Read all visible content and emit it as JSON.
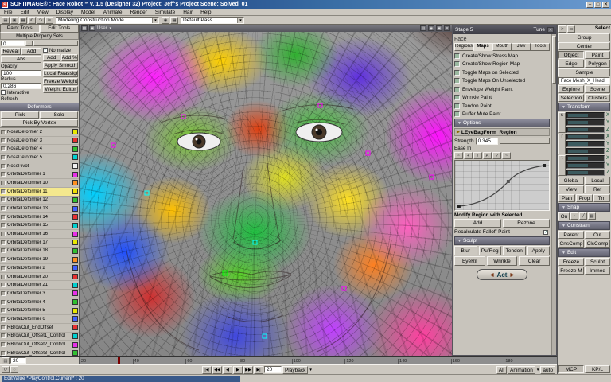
{
  "title_bar": {
    "app_icon": "S",
    "title": "SOFTIMAGE® : Face Robot™ v. 1.5 (Designer 32) Project: Jeff's Project    Scene: Solved_01",
    "window_buttons": {
      "minimize": "–",
      "maximize": "□",
      "close": "✕"
    }
  },
  "menu_bar": {
    "items": [
      "File",
      "Edit",
      "View",
      "Display",
      "Model",
      "Animate",
      "Render",
      "Simulate",
      "Hair",
      "Help"
    ]
  },
  "toolbar": {
    "mode_combo": "Modeling Construction Mode",
    "pass_combo": "Default Pass"
  },
  "paint_panel": {
    "tabs": [
      "Paint Tools",
      "Edit Tools"
    ],
    "title": "Multiple Property Sets",
    "weight_value": "0",
    "left": {
      "reveal": "Reveal",
      "add": "Add",
      "abs": "Abs",
      "opacity_label": "Opacity",
      "opacity_value": "100",
      "radius_label": "Radius",
      "radius_value": "0.286",
      "interactive_refresh": "Interactive Refresh"
    },
    "right": {
      "normalize": "Normalize",
      "add": "Add",
      "add_pct": "Add %",
      "apply_smooth": "Apply Smooth",
      "local_reassign": "Local Reassign",
      "freeze_weights": "Freeze Weights",
      "weight_editor": "Weight Editor"
    },
    "deformers_header": "Deformers",
    "pick": "Pick",
    "solo": "Solo",
    "pick_by_vertex": "Pick By Vertex"
  },
  "deformers": {
    "items": [
      {
        "label": "NosaDeformer 2",
        "color": "#e8e800"
      },
      {
        "label": "NosaDeformer 3",
        "color": "#e83030"
      },
      {
        "label": "NosaDeformer 4",
        "color": "#30c030"
      },
      {
        "label": "NosaDeformer 5",
        "color": "#00d0d0"
      },
      {
        "label": "NosePivot",
        "color": "#f0f0f0"
      },
      {
        "label": "OrbitalDeformer 1",
        "color": "#e830e8"
      },
      {
        "label": "OrbitalDeformer 10",
        "color": "#ff9020"
      },
      {
        "label": "OrbitalDeformer 11",
        "color": "#f0e000",
        "selected": true
      },
      {
        "label": "OrbitalDeformer 12",
        "color": "#30c030"
      },
      {
        "label": "OrbitalDeformer 13",
        "color": "#4060ff"
      },
      {
        "label": "OrbitalDeformer 14",
        "color": "#e83030"
      },
      {
        "label": "OrbitalDeformer 15",
        "color": "#00d0d0"
      },
      {
        "label": "OrbitalDeformer 16",
        "color": "#e830e8"
      },
      {
        "label": "OrbitalDeformer 17",
        "color": "#e8e800"
      },
      {
        "label": "OrbitalDeformer 18",
        "color": "#30c030"
      },
      {
        "label": "OrbitalDeformer 19",
        "color": "#ff9020"
      },
      {
        "label": "OrbitalDeformer 2",
        "color": "#4060ff"
      },
      {
        "label": "OrbitalDeformer 20",
        "color": "#e83030"
      },
      {
        "label": "OrbitalDeformer 21",
        "color": "#00d0d0"
      },
      {
        "label": "OrbitalDeformer 3",
        "color": "#e830e8"
      },
      {
        "label": "OrbitalDeformer 4",
        "color": "#30c030"
      },
      {
        "label": "OrbitalDeformer 5",
        "color": "#e8e800"
      },
      {
        "label": "OrbitalDeformer 6",
        "color": "#4060ff"
      },
      {
        "label": "RBrowOut_EndOffset",
        "color": "#e83030"
      },
      {
        "label": "RBrowOut_Offset1_Control",
        "color": "#00d0d0"
      },
      {
        "label": "RBrowOut_Offset2_Control",
        "color": "#e830e8"
      },
      {
        "label": "RBrowOut_Offset3_Control",
        "color": "#30c030"
      }
    ]
  },
  "viewport": {
    "view": "User"
  },
  "tune_panel": {
    "title": "Stage 5",
    "title2": "Tune",
    "face": {
      "label": "Face",
      "tabs": [
        "Regions",
        "Maps",
        "Mouth",
        "Jaw",
        "Tools"
      ],
      "active_tab": "Maps",
      "items": [
        "Create/Show Stress Map",
        "Create/Show Region Map",
        "Toggle Maps on Selected",
        "Toggle Maps On Unselected",
        "Envelope Weight Paint",
        "Wrinkle Paint",
        "Tendon Paint",
        "Puffer Mute Paint"
      ]
    },
    "options": {
      "header": "Options",
      "region": "LEyeBagForm_Region",
      "strength_label": "Strength",
      "strength_value": "0.345",
      "ease_label": "Ease In",
      "ease_icons": [
        {
          "name": "select-icon",
          "glyph": "▫"
        },
        {
          "name": "move-icon",
          "glyph": "+"
        },
        {
          "name": "pencil-icon",
          "glyph": "/"
        },
        {
          "name": "text-icon",
          "glyph": "A"
        },
        {
          "name": "help-icon",
          "glyph": "?"
        },
        {
          "name": "curve-icon",
          "glyph": "~"
        }
      ],
      "modify_label": "Modify Region with Selected",
      "add_button": "Add",
      "rezone_button": "Rezone",
      "recalc_label": "Recalculate Falloff Paint",
      "recalc_check": "✓"
    },
    "sculpt": {
      "header": "Sculpt",
      "row1": [
        "Blur",
        "PufReg",
        "Tendon",
        "Apply"
      ],
      "row2": [
        "EyeRil",
        "Wrinkle",
        "Clear"
      ]
    },
    "act_button": "Act"
  },
  "mcp": {
    "select_header": "Select",
    "group": "Group",
    "center": "Center",
    "object": "Object",
    "paint": "Paint",
    "edge": "Edge",
    "polygon": "Polygon",
    "sample": "Sample",
    "selection_field": "Face Mesh_X_Head",
    "explore": "Explore",
    "scene": "Scene",
    "selection": "Selection",
    "clusters": "Clusters",
    "transform_header": "Transform",
    "srt": [
      "s",
      "r",
      "t"
    ],
    "axes": [
      "X",
      "Y",
      "Z"
    ],
    "global": "Global",
    "local": "Local",
    "view": "View",
    "ref": "Ref",
    "plan": "Plan",
    "snap_header": "Snap",
    "snap_on": "On",
    "prop": "Prop",
    "trn": "Trn",
    "constrain_header": "Constrain",
    "parent": "Parent",
    "cut": "Cut",
    "cnscomp": "CnsComp",
    "clscomp": "ClsComp",
    "edit_header": "Edit",
    "freeze": "Freeze",
    "sculpt": "Sculpt",
    "freeze_m": "Freeze M",
    "immed": "Immed",
    "mcp_label": "MCP",
    "kpl_label": "KP/L"
  },
  "timeline": {
    "ticks": [
      "20",
      "40",
      "60",
      "80",
      "100",
      "120",
      "140",
      "160",
      "180"
    ],
    "current_frame": "20"
  },
  "playback": {
    "transport": [
      "|◀",
      "◀◀",
      "◀",
      "▶",
      "▶▶",
      "▶|"
    ],
    "frame": "20",
    "playback_button": "Playback",
    "all": "All",
    "animation": "Animation",
    "auto": "auto"
  },
  "status_bar": {
    "text": "EditValue *PlayControl.Current* : 20"
  }
}
